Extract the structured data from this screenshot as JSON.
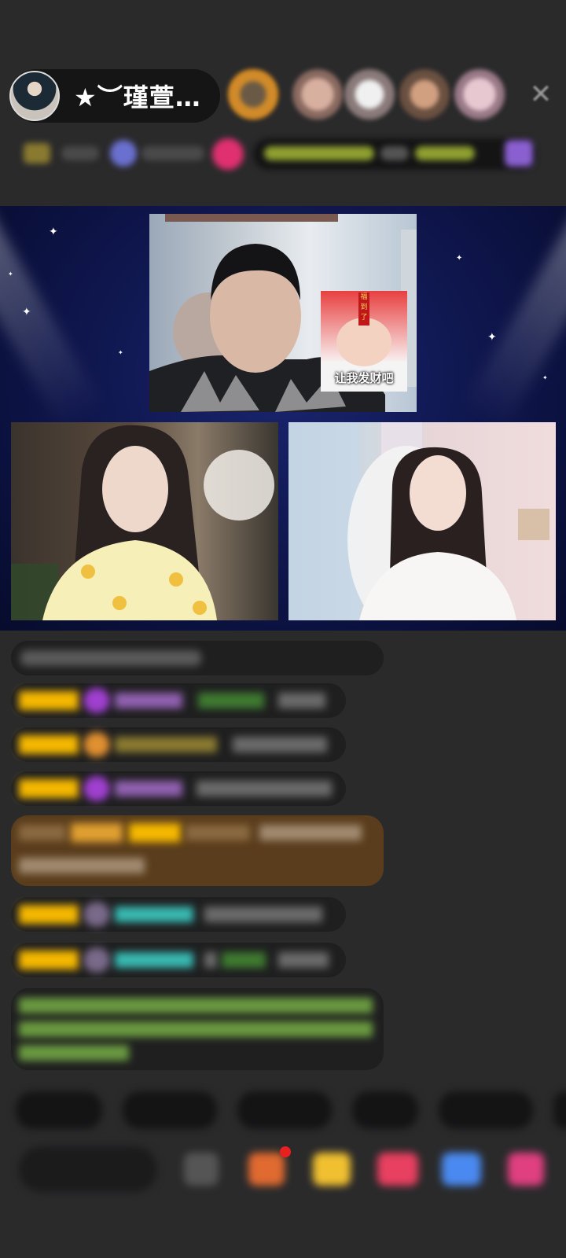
{
  "header": {
    "host_name": "★︶瑾萱…",
    "close_icon": "✕"
  },
  "stage": {
    "sticker_caption": "让我发财吧",
    "sticker_tag": "福 到 了"
  },
  "colors": {
    "background": "#2a2a2b",
    "stage_top": "#1a2570",
    "stage_bottom": "#070b2c",
    "badge_gold": "#f5b800",
    "chat_teal": "#38b8b0",
    "chat_green": "#7fbf50",
    "chat_purple": "#b070e0"
  }
}
